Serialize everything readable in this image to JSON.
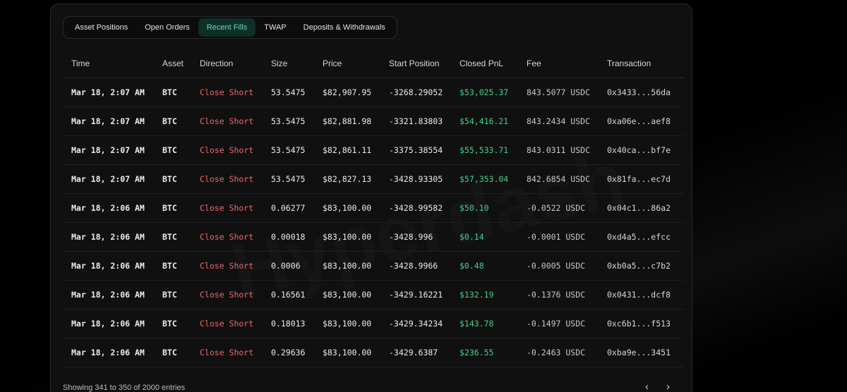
{
  "tabs": [
    {
      "label": "Asset Positions"
    },
    {
      "label": "Open Orders"
    },
    {
      "label": "Recent Fills"
    },
    {
      "label": "TWAP"
    },
    {
      "label": "Deposits & Withdrawals"
    }
  ],
  "active_tab": "Recent Fills",
  "watermark": "Hyperdash",
  "table": {
    "headers": [
      "Time",
      "Asset",
      "Direction",
      "Size",
      "Price",
      "Start Position",
      "Closed PnL",
      "Fee",
      "Transaction"
    ],
    "rows": [
      {
        "time": "Mar 18, 2:07 AM",
        "asset": "BTC",
        "direction": "Close Short",
        "size": "53.5475",
        "price": "$82,907.95",
        "start_position": "-3268.29052",
        "closed_pnl": "$53,025.37",
        "fee": "843.5077 USDC",
        "transaction": "0x3433...56da"
      },
      {
        "time": "Mar 18, 2:07 AM",
        "asset": "BTC",
        "direction": "Close Short",
        "size": "53.5475",
        "price": "$82,881.98",
        "start_position": "-3321.83803",
        "closed_pnl": "$54,416.21",
        "fee": "843.2434 USDC",
        "transaction": "0xa06e...aef8"
      },
      {
        "time": "Mar 18, 2:07 AM",
        "asset": "BTC",
        "direction": "Close Short",
        "size": "53.5475",
        "price": "$82,861.11",
        "start_position": "-3375.38554",
        "closed_pnl": "$55,533.71",
        "fee": "843.0311 USDC",
        "transaction": "0x40ca...bf7e"
      },
      {
        "time": "Mar 18, 2:07 AM",
        "asset": "BTC",
        "direction": "Close Short",
        "size": "53.5475",
        "price": "$82,827.13",
        "start_position": "-3428.93305",
        "closed_pnl": "$57,353.04",
        "fee": "842.6854 USDC",
        "transaction": "0x81fa...ec7d"
      },
      {
        "time": "Mar 18, 2:06 AM",
        "asset": "BTC",
        "direction": "Close Short",
        "size": "0.06277",
        "price": "$83,100.00",
        "start_position": "-3428.99582",
        "closed_pnl": "$50.10",
        "fee": "-0.0522 USDC",
        "transaction": "0x04c1...86a2"
      },
      {
        "time": "Mar 18, 2:06 AM",
        "asset": "BTC",
        "direction": "Close Short",
        "size": "0.00018",
        "price": "$83,100.00",
        "start_position": "-3428.996",
        "closed_pnl": "$0.14",
        "fee": "-0.0001 USDC",
        "transaction": "0xd4a5...efcc"
      },
      {
        "time": "Mar 18, 2:06 AM",
        "asset": "BTC",
        "direction": "Close Short",
        "size": "0.0006",
        "price": "$83,100.00",
        "start_position": "-3428.9966",
        "closed_pnl": "$0.48",
        "fee": "-0.0005 USDC",
        "transaction": "0xb0a5...c7b2"
      },
      {
        "time": "Mar 18, 2:06 AM",
        "asset": "BTC",
        "direction": "Close Short",
        "size": "0.16561",
        "price": "$83,100.00",
        "start_position": "-3429.16221",
        "closed_pnl": "$132.19",
        "fee": "-0.1376 USDC",
        "transaction": "0x0431...dcf8"
      },
      {
        "time": "Mar 18, 2:06 AM",
        "asset": "BTC",
        "direction": "Close Short",
        "size": "0.18013",
        "price": "$83,100.00",
        "start_position": "-3429.34234",
        "closed_pnl": "$143.78",
        "fee": "-0.1497 USDC",
        "transaction": "0xc6b1...f513"
      },
      {
        "time": "Mar 18, 2:06 AM",
        "asset": "BTC",
        "direction": "Close Short",
        "size": "0.29636",
        "price": "$83,100.00",
        "start_position": "-3429.6387",
        "closed_pnl": "$236.55",
        "fee": "-0.2463 USDC",
        "transaction": "0xba9e...3451"
      }
    ]
  },
  "footer": {
    "entries_text": "Showing 341 to 350 of 2000 entries",
    "prev_glyph": "‹",
    "next_glyph": "›"
  },
  "colors": {
    "accent": "#5fe0b8",
    "short": "#f0686b",
    "profit": "#3fd48b"
  }
}
